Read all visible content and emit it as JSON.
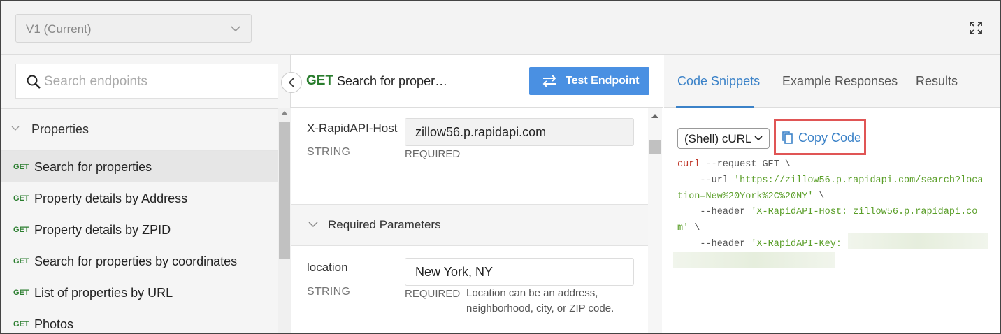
{
  "header": {
    "version_label": "V1 (Current)"
  },
  "sidebar": {
    "search_placeholder": "Search endpoints",
    "group_title": "Properties",
    "items": [
      {
        "method": "GET",
        "label": "Search for properties"
      },
      {
        "method": "GET",
        "label": "Property details by Address"
      },
      {
        "method": "GET",
        "label": "Property details by ZPID"
      },
      {
        "method": "GET",
        "label": "Search for properties by coordinates"
      },
      {
        "method": "GET",
        "label": "List of properties by URL"
      },
      {
        "method": "GET",
        "label": "Photos"
      }
    ]
  },
  "endpoint": {
    "method": "GET",
    "title": "Search for proper…",
    "test_button_label": "Test Endpoint",
    "header_param": {
      "name": "X-RapidAPI-Host",
      "type": "STRING",
      "value": "zillow56.p.rapidapi.com",
      "required": "REQUIRED"
    },
    "required_section_title": "Required Parameters",
    "required_param": {
      "name": "location",
      "type": "STRING",
      "value": "New York, NY",
      "required": "REQUIRED",
      "description": "Location can be an address, neighborhood, city, or ZIP code."
    }
  },
  "snippets": {
    "tabs": [
      "Code Snippets",
      "Example Responses",
      "Results"
    ],
    "language": "(Shell) cURL",
    "copy_label": "Copy Code",
    "code": {
      "l1_cmd": "curl",
      "l1_rest": " --request GET \\",
      "l2_flag": "    --url ",
      "l2_str": "'https://zillow56.p.rapidapi.com/search?loca",
      "l3_str": "tion=New%20York%2C%20NY'",
      "l3_rest": " \\",
      "l4_flag": "    --header ",
      "l4_str": "'X-RapidAPI-Host: zillow56.p.rapidapi.co",
      "l5_str": "m'",
      "l5_rest": " \\",
      "l6_flag": "    --header ",
      "l6_str": "'X-RapidAPI-Key: "
    }
  },
  "colors": {
    "accent_blue": "#4a90e2",
    "link_blue": "#3b82c8",
    "get_green": "#2a7d2e",
    "highlight_red": "#e05555"
  }
}
